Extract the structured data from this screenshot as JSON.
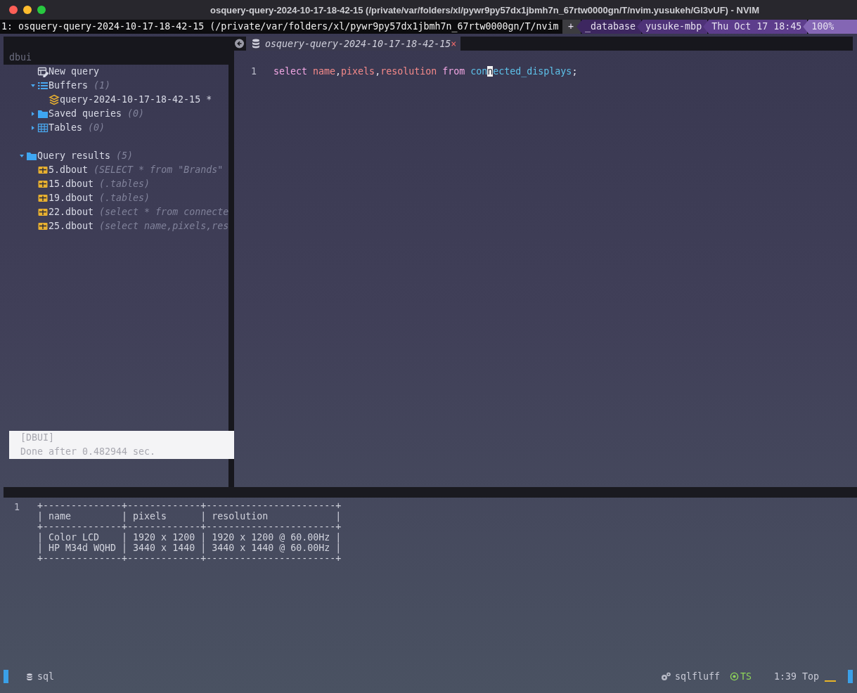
{
  "window": {
    "title": "osquery-query-2024-10-17-18-42-15 (/private/var/folders/xl/pywr9py57dx1jbmh7n_67rtw0000gn/T/nvim.yusukeh/Gl3vUF) - NVIM"
  },
  "tmux": {
    "window": "1: osquery-query-2024-10-17-18-42-15 (/private/var/folders/xl/pywr9py57dx1jbmh7n_67rtw0000gn/T/nvim",
    "segments": [
      {
        "text": "+",
        "kind": "flag"
      },
      {
        "text": "_database",
        "kind": "session"
      },
      {
        "text": "yusuke-mbp",
        "kind": "host"
      },
      {
        "text": "Thu Oct 17 18:45",
        "kind": "clock"
      },
      {
        "text": "100%",
        "kind": "battery"
      }
    ]
  },
  "sidebar": {
    "title": "dbui",
    "sections": [
      {
        "kind": "connection",
        "items": [
          {
            "label": "New query",
            "kind": "new-query"
          },
          {
            "label": "Buffers",
            "count": "(1)",
            "kind": "list",
            "expanded": true,
            "children": [
              {
                "label": "query-2024-10-17-18-42-15 *",
                "kind": "layers"
              }
            ]
          },
          {
            "label": "Saved queries",
            "count": "(0)",
            "kind": "folder",
            "expanded": false
          },
          {
            "label": "Tables",
            "count": "(0)",
            "kind": "table",
            "expanded": false
          }
        ]
      },
      {
        "kind": "results",
        "items": [
          {
            "label": "Query results",
            "count": "(5)",
            "kind": "folder",
            "expanded": true,
            "children": [
              {
                "label": "5.dbout",
                "count": "(SELECT * from \"Brands\"",
                "kind": "result"
              },
              {
                "label": "15.dbout",
                "count": "(.tables)",
                "kind": "result"
              },
              {
                "label": "19.dbout",
                "count": "(.tables)",
                "kind": "result"
              },
              {
                "label": "22.dbout",
                "count": "(select * from connecte",
                "kind": "result"
              },
              {
                "label": "25.dbout",
                "count": "(select name,pixels,res",
                "kind": "result"
              }
            ]
          }
        ]
      }
    ]
  },
  "tab": {
    "title": "osquery-query-2024-10-17-18-42-15",
    "close": "×"
  },
  "editor": {
    "lines": [
      {
        "number": "1",
        "tokens": [
          {
            "text": "select ",
            "kind": "keyword"
          },
          {
            "text": "name",
            "kind": "column"
          },
          {
            "text": ",",
            "kind": "plain"
          },
          {
            "text": "pixels",
            "kind": "column"
          },
          {
            "text": ",",
            "kind": "plain"
          },
          {
            "text": "resolution ",
            "kind": "column"
          },
          {
            "text": "from ",
            "kind": "keyword"
          },
          {
            "text": "con",
            "kind": "table"
          },
          {
            "text": "n",
            "kind": "cursor"
          },
          {
            "text": "ected_displays",
            "kind": "table"
          },
          {
            "text": ";",
            "kind": "plain"
          }
        ]
      }
    ]
  },
  "notification": {
    "title": "[DBUI]",
    "message": "Done after 0.482944 sec."
  },
  "results": {
    "line_number": "1",
    "lines": [
      "+--------------+-------------+-----------------------+",
      "| name         | pixels      | resolution            |",
      "+--------------+-------------+-----------------------+",
      "| Color LCD    | 1920 x 1200 | 1920 x 1200 @ 60.00Hz |",
      "| HP M34d WQHD | 3440 x 1440 | 3440 x 1440 @ 60.00Hz |",
      "+--------------+-------------+-----------------------+"
    ]
  },
  "status_bar": {
    "filetype": "sql",
    "linter": "sqlfluff",
    "treesitter": "TS",
    "position": "1:39",
    "scroll": "Top"
  }
}
